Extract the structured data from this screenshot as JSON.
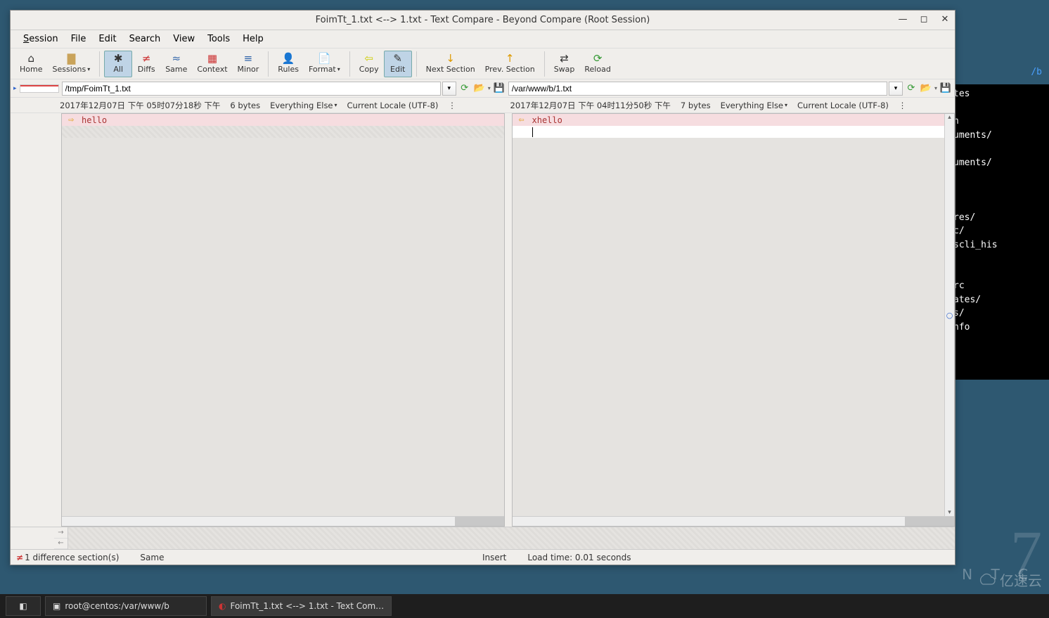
{
  "window": {
    "title": "FoimTt_1.txt <--> 1.txt - Text Compare - Beyond Compare (Root Session)"
  },
  "menu": {
    "session": "Session",
    "file": "File",
    "edit": "Edit",
    "search": "Search",
    "view": "View",
    "tools": "Tools",
    "help": "Help"
  },
  "toolbar": {
    "home": "Home",
    "sessions": "Sessions",
    "all": "All",
    "diffs": "Diffs",
    "same": "Same",
    "context": "Context",
    "minor": "Minor",
    "rules": "Rules",
    "format": "Format",
    "copy": "Copy",
    "edit_btn": "Edit",
    "next": "Next Section",
    "prev": "Prev. Section",
    "swap": "Swap",
    "reload": "Reload"
  },
  "left": {
    "path": "/tmp/FoimTt_1.txt",
    "timestamp": "2017年12月07日 下午 05时07分18秒 下午",
    "size": "6 bytes",
    "filter": "Everything Else",
    "encoding": "Current Locale (UTF-8)",
    "line1": "hello"
  },
  "right": {
    "path": "/var/www/b/1.txt",
    "timestamp": "2017年12月07日 下午 04时11分50秒 下午",
    "size": "7 bytes",
    "filter": "Everything Else",
    "encoding": "Current Locale (UTF-8)",
    "line1": "xhello"
  },
  "status": {
    "differences": "1 difference section(s)",
    "same": "Same",
    "mode": "Insert",
    "load": "Load time: 0.01 seconds"
  },
  "taskbar": {
    "item1": "root@centos:/var/www/b",
    "item2": "FoimTt_1.txt <--> 1.txt - Text Com…"
  },
  "terminal": {
    "path": "/b",
    "lines": "tes\n\nh\numents/\n\numents/\n\n\n\nres/\nc/\nscli_his\n\n\nrc\nates/\ns/\nnfo"
  },
  "watermark": "亿速云",
  "centos_label": "N T C"
}
